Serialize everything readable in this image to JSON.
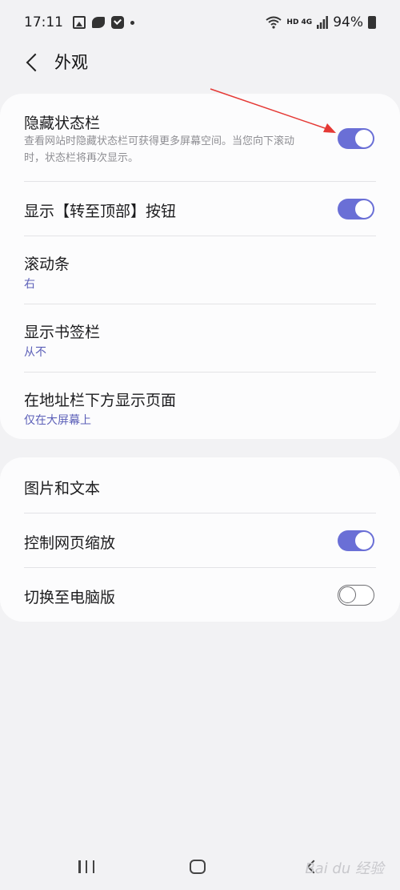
{
  "status_bar": {
    "time": "17:11",
    "network": "HD 4G",
    "battery": "94%",
    "icons": [
      "image-icon",
      "bird-app-icon",
      "check-app-icon",
      "dot-icon",
      "wifi-icon",
      "signal-icon",
      "battery-icon"
    ]
  },
  "header": {
    "title": "外观"
  },
  "section1": {
    "items": [
      {
        "title": "隐藏状态栏",
        "desc": "查看网站时隐藏状态栏可获得更多屏幕空间。当您向下滚动时，状态栏将再次显示。",
        "toggle": true
      },
      {
        "title": "显示【转至顶部】按钮",
        "toggle": true
      },
      {
        "title": "滚动条",
        "value": "右"
      },
      {
        "title": "显示书签栏",
        "value": "从不"
      },
      {
        "title": "在地址栏下方显示页面",
        "value": "仅在大屏幕上"
      }
    ]
  },
  "section2": {
    "items": [
      {
        "title": "图片和文本"
      },
      {
        "title": "控制网页缩放",
        "toggle": true
      },
      {
        "title": "切换至电脑版",
        "toggle": false
      }
    ]
  },
  "watermark": "Bai du 经验",
  "colors": {
    "accent": "#6a6fd6",
    "subtext": "#5b5fb8",
    "annotation": "#e53935",
    "background": "#f2f2f4",
    "card": "#fcfcfd"
  }
}
